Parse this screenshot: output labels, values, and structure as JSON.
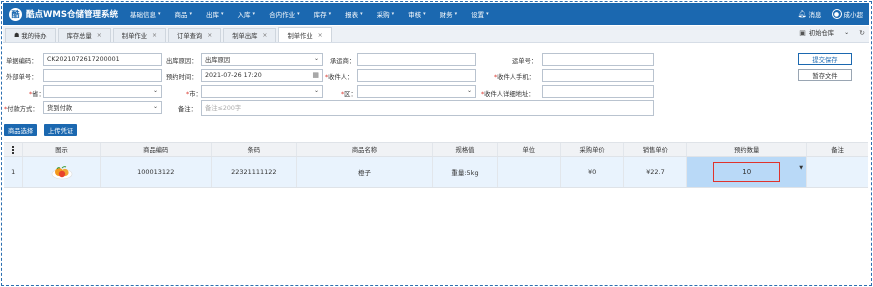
{
  "app": {
    "title": "酷点WMS仓储管理系统",
    "logo_glyph": "酷"
  },
  "nav": {
    "menu": [
      "基础信息",
      "商品",
      "出库",
      "入库",
      "合内作业",
      "库存",
      "报表",
      "采购",
      "审核",
      "财务",
      "设置"
    ],
    "caret": "▾",
    "messages_label": "消息",
    "user_label": "成小超"
  },
  "tabs": [
    {
      "label": "我的待办",
      "closable": false
    },
    {
      "label": "库存总量",
      "closable": true
    },
    {
      "label": "制单作业",
      "closable": true
    },
    {
      "label": "订单查询",
      "closable": true
    },
    {
      "label": "制单出库",
      "closable": true
    },
    {
      "label": "制单作业",
      "closable": true,
      "active": true
    }
  ],
  "tab_close": "×",
  "warehouse": {
    "label": "初始仓库"
  },
  "form": {
    "order_no": {
      "label": "单据编码：",
      "value": "CK2021072617200001"
    },
    "outbound_reason": {
      "label": "出库原因：",
      "value": "出库原因"
    },
    "carrier": {
      "label": "承运商：",
      "value": ""
    },
    "waybill_no": {
      "label": "运单号：",
      "value": ""
    },
    "external_no": {
      "label": "外部单号：",
      "value": ""
    },
    "scheduled_time": {
      "label": "预约时间：",
      "value": "2021-07-26 17:20"
    },
    "recipient": {
      "label": "收件人：",
      "value": ""
    },
    "recipient_phone": {
      "label": "收件人手机：",
      "value": ""
    },
    "province": {
      "label": "省：",
      "value": ""
    },
    "city": {
      "label": "市：",
      "value": ""
    },
    "district": {
      "label": "区：",
      "value": ""
    },
    "recipient_address": {
      "label": "收件人详细地址：",
      "value": ""
    },
    "payment_method": {
      "label": "付款方式：",
      "value": "货到付款"
    },
    "remark": {
      "label": "备注：",
      "placeholder": "备注≤200字"
    },
    "required_mark": "*"
  },
  "buttons": {
    "submit_save": "提交保存",
    "temp_save": "暂存文件",
    "select_product": "商品选择",
    "upload_voucher": "上传凭证"
  },
  "table": {
    "columns": [
      "",
      "图示",
      "商品编码",
      "条码",
      "商品名称",
      "规格值",
      "单位",
      "采购单价",
      "销售单价",
      "预约数量",
      "备注"
    ],
    "rows": [
      {
        "index": "1",
        "image": "orange-icon",
        "product_code": "100013122",
        "barcode": "22321111122",
        "product_name": "橙子",
        "spec": "重量:5kg",
        "unit": "",
        "purchase_price": "¥0",
        "sale_price": "¥22.7",
        "booked_qty": "10",
        "remark": ""
      }
    ]
  },
  "colors": {
    "brand": "#1b68b0",
    "row_highlight": "#e9f3fd",
    "edit_cell": "#b9d9f7",
    "edit_border": "#e0332c"
  }
}
